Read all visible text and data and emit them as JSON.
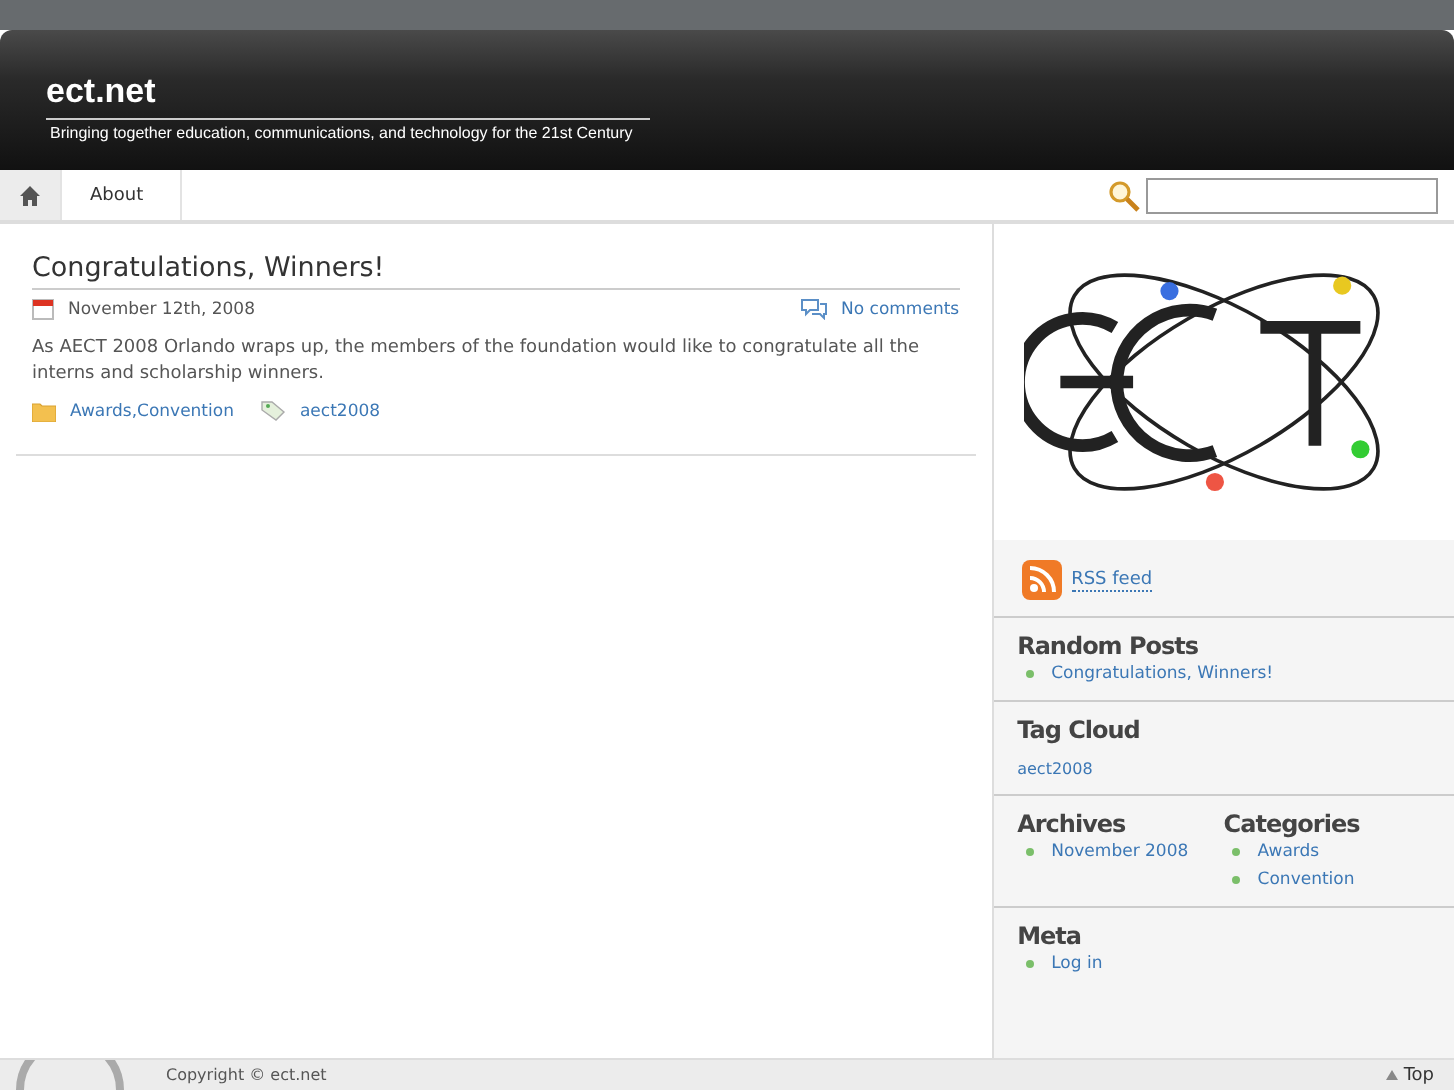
{
  "header": {
    "title": "ect.net",
    "tagline": "Bringing together education, communications, and technology for the 21st Century"
  },
  "nav": {
    "items": [
      {
        "kind": "home",
        "selected": true
      },
      {
        "kind": "page",
        "label": "About",
        "selected": false
      }
    ],
    "search": {
      "kind": "text"
    }
  },
  "post": {
    "title": "Congratulations, Winners!",
    "date": "November 12th, 2008",
    "comments": "No comments",
    "excerpt": "As AECT 2008 Orlando wraps up, the members of the foundation would like to congratulate all the interns and scholarship winners.",
    "categories": [
      "Awards",
      "Convention"
    ],
    "category_separator": ",",
    "tags": [
      "aect2008"
    ]
  },
  "sidebar": {
    "rss": "RSS feed",
    "random_posts": {
      "title": "Random Posts",
      "items": [
        "Congratulations, Winners!"
      ]
    },
    "tag_cloud": {
      "title": "Tag Cloud",
      "tags": [
        "aect2008"
      ]
    },
    "archives": {
      "title": "Archives",
      "items": [
        "November 2008"
      ]
    },
    "categories": {
      "title": "Categories",
      "items": [
        "Awards",
        "Convention"
      ]
    },
    "meta": {
      "title": "Meta",
      "items": [
        "Log in"
      ]
    }
  },
  "footer": {
    "copyright": "Copyright © ect.net",
    "top": "Top"
  }
}
